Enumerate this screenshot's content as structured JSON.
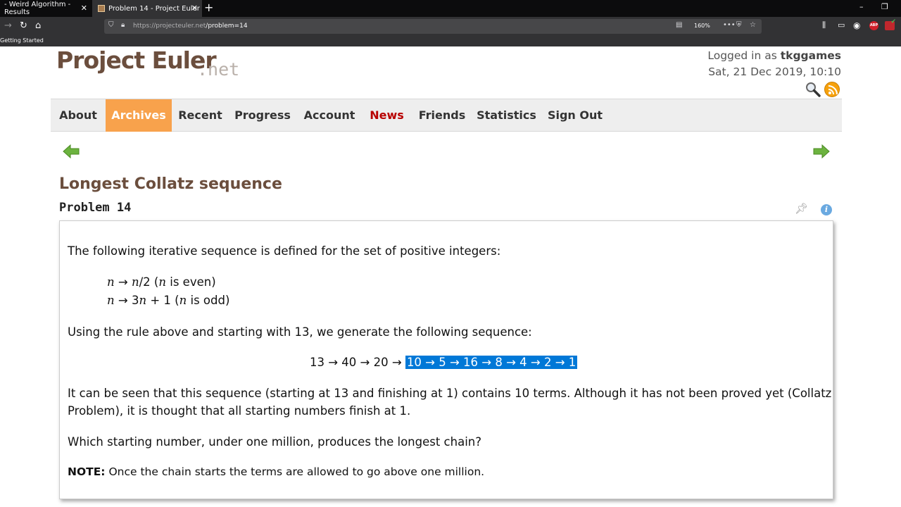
{
  "browser": {
    "tabs": [
      {
        "title": "- Weird Algorithm - Results",
        "active": false
      },
      {
        "title": "Problem 14 - Project Euler",
        "active": true
      }
    ],
    "url_host": "https://projecteuler.net",
    "url_path": "/problem=14",
    "zoom": "160%",
    "bookmark": "Getting Started",
    "addon_abp": "ABP"
  },
  "site": {
    "logo_main": "Project Euler",
    "logo_suffix": ".net",
    "logged_in_prefix": "Logged in as ",
    "username": "tkggames",
    "datetime": "Sat, 21 Dec 2019, 10:10"
  },
  "menu": {
    "items": [
      {
        "label": "About"
      },
      {
        "label": "Archives",
        "active": true
      },
      {
        "label": "Recent"
      },
      {
        "label": "Progress"
      },
      {
        "label": "Account"
      },
      {
        "label": "News",
        "highlight": true
      },
      {
        "label": "Friends"
      },
      {
        "label": "Statistics"
      },
      {
        "label": "Sign Out"
      }
    ]
  },
  "problem": {
    "title": "Longest Collatz sequence",
    "number_label": "Problem 14",
    "intro": "The following iterative sequence is defined for the set of positive integers:",
    "rule_even": {
      "n": "n",
      "arrow": " → ",
      "n2": "n",
      "rest": "/2 (",
      "n3": "n",
      "tail": " is even)"
    },
    "rule_odd": {
      "n": "n",
      "arrow": " → 3",
      "n2": "n",
      "rest": " + 1 (",
      "n3": "n",
      "tail": " is odd)"
    },
    "using": "Using the rule above and starting with 13, we generate the following sequence:",
    "sequence_plain": "13 → 40 → 20 → ",
    "sequence_selected": "10 → 5 → 16 → 8 → 4 → 2 → 1",
    "observation_line1": "It can be seen that this sequence (starting at 13 and finishing at 1) contains 10 terms. Although it has not been proved yet (Collatz",
    "observation_line2": "Problem), it is thought that all starting numbers finish at 1.",
    "question": "Which starting number, under one million, produces the longest chain?",
    "note_label": "NOTE:",
    "note_text": " Once the chain starts the terms are allowed to go above one million."
  },
  "colors": {
    "brand_brown": "#6b4e3d",
    "menu_active": "#f8a24c",
    "news_red": "#b80000",
    "selection": "#0078d7"
  }
}
